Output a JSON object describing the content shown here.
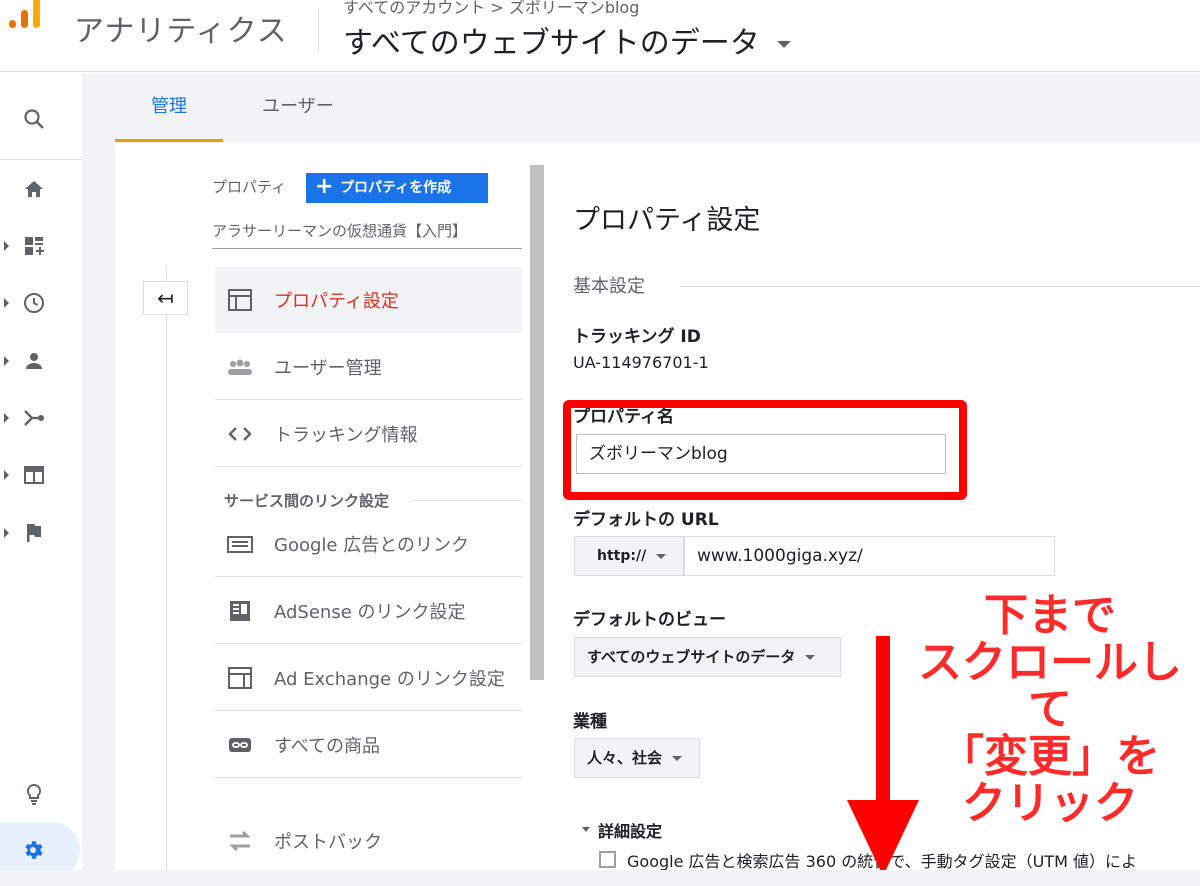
{
  "header": {
    "app_title": "アナリティクス",
    "breadcrumb": "すべてのアカウント > ズボリーマンblog",
    "view_title": "すべてのウェブサイトのデータ",
    "logo_colors": [
      "#f9ab00",
      "#e37400",
      "#e37400"
    ]
  },
  "rail": {
    "icons": [
      "search-icon",
      "home-icon",
      "customization-icon",
      "realtime-clock-icon",
      "audience-person-icon",
      "acquisition-icon",
      "behavior-icon",
      "conversions-flag-icon",
      "lightbulb-icon",
      "settings-gear-icon"
    ]
  },
  "tabs": {
    "admin": "管理",
    "user": "ユーザー"
  },
  "property_column": {
    "label": "プロパティ",
    "create_button": "プロパティを作成",
    "create_plus": "+",
    "property_name": "アラサーリーマンの仮想通貨【入門】",
    "back_icon": "↤",
    "items": [
      {
        "label": "プロパティ設定",
        "icon": "property-layout-icon"
      },
      {
        "label": "ユーザー管理",
        "icon": "users-group-icon"
      },
      {
        "label": "トラッキング情報",
        "icon": "code-brackets-icon"
      }
    ],
    "section_label": "サービス間のリンク設定",
    "link_items": [
      {
        "label": "Google 広告とのリンク",
        "icon": "google-ads-icon"
      },
      {
        "label": "AdSense のリンク設定",
        "icon": "adsense-icon"
      },
      {
        "label": "Ad Exchange のリンク設定",
        "icon": "ad-exchange-icon"
      },
      {
        "label": "すべての商品",
        "icon": "link-chain-icon"
      },
      {
        "label": "ポストバック",
        "icon": "postback-arrows-icon"
      }
    ]
  },
  "settings": {
    "title": "プロパティ設定",
    "basic_label": "基本設定",
    "tracking_id_label": "トラッキング ID",
    "tracking_id": "UA-114976701-1",
    "property_name_label": "プロパティ名",
    "property_name_value": "ズボリーマンblog",
    "default_url_label": "デフォルトの URL",
    "url_protocol": "http://",
    "url_value": "www.1000giga.xyz/",
    "default_view_label": "デフォルトのビュー",
    "default_view_value": "すべてのウェブサイトのデータ",
    "industry_label": "業種",
    "industry_value": "人々、社会",
    "advanced_label": "詳細設定",
    "checkbox_label": "Google 広告と検索広告 360 の統合で、手動タグ設定（UTM 値）によ"
  },
  "annotation": {
    "lines": [
      "下まで",
      "スクロールして",
      "「変更」を",
      "クリック"
    ],
    "color": "#ff0000"
  }
}
